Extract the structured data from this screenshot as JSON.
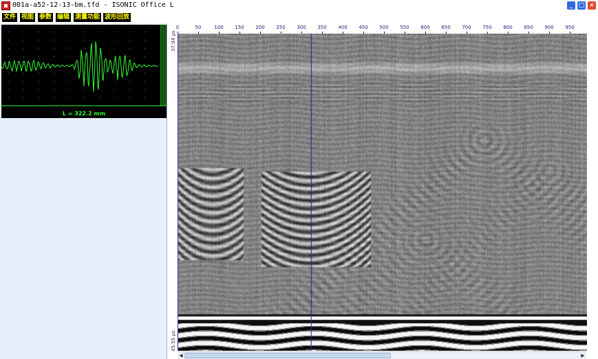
{
  "window": {
    "title": "001a-a52-12-13-bm.tfd - ISONIC Office L",
    "minimize_glyph": "_",
    "maximize_glyph": "□",
    "close_glyph": "×"
  },
  "menu": {
    "items": [
      {
        "label": "文件"
      },
      {
        "label": "视图"
      },
      {
        "label": "参数"
      },
      {
        "label": "编辑"
      },
      {
        "label": "测量功能"
      },
      {
        "label": "波形回放"
      }
    ]
  },
  "ascan": {
    "length_label": "L = 322.2 mm"
  },
  "bscan": {
    "ruler_ticks": [
      "0",
      "50",
      "100",
      "150",
      "200",
      "250",
      "300",
      "350",
      "400",
      "450",
      "500",
      "550",
      "600",
      "650",
      "700",
      "750",
      "800",
      "850",
      "900",
      "950"
    ],
    "y_top_label": "37.94 µs",
    "y_bottom_label": "45.55 µs",
    "cursor_value": 322.2
  },
  "colors": {
    "ascan_trace": "#33ff33",
    "cursor": "#2222cc"
  },
  "icons": {
    "app": "isonic-app-icon",
    "minimize": "minimize-icon",
    "maximize": "maximize-icon",
    "close": "close-icon"
  }
}
